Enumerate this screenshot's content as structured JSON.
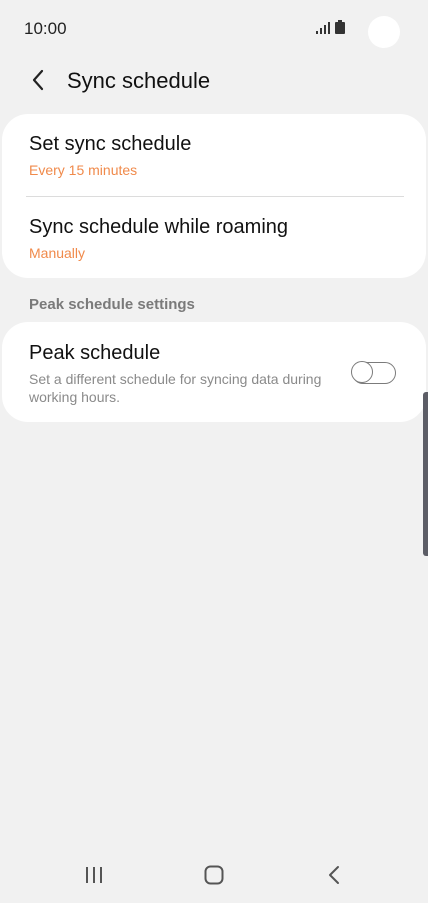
{
  "status_bar": {
    "time": "10:00"
  },
  "header": {
    "title": "Sync schedule"
  },
  "settings_card": {
    "rows": [
      {
        "title": "Set sync schedule",
        "value": "Every 15 minutes"
      },
      {
        "title": "Sync schedule while roaming",
        "value": "Manually"
      }
    ]
  },
  "peak_section": {
    "header": "Peak schedule settings",
    "title": "Peak schedule",
    "description": "Set a different schedule for syncing data during working hours.",
    "toggle_on": false
  },
  "colors": {
    "accent": "#f08a4b",
    "background": "#f1f1f1",
    "card": "#ffffff"
  }
}
